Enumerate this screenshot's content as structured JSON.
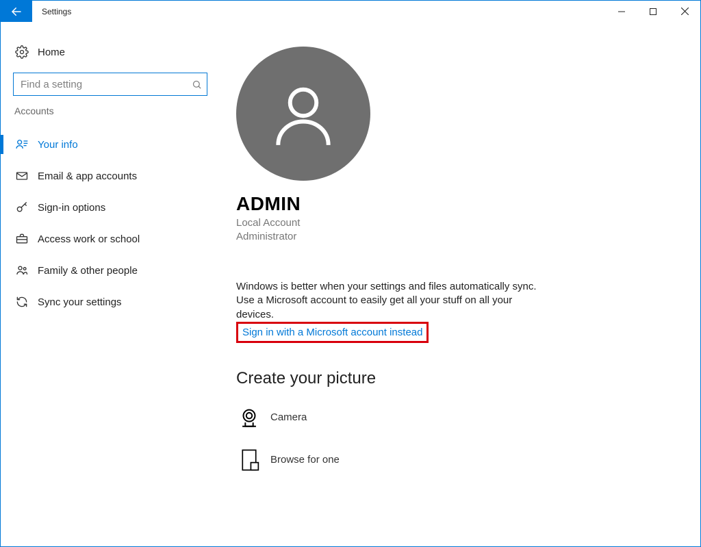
{
  "title": "Settings",
  "home_label": "Home",
  "search": {
    "placeholder": "Find a setting"
  },
  "section_header": "Accounts",
  "nav": [
    {
      "id": "your-info",
      "label": "Your info",
      "selected": true
    },
    {
      "id": "email-app",
      "label": "Email & app accounts",
      "selected": false
    },
    {
      "id": "signin-options",
      "label": "Sign-in options",
      "selected": false
    },
    {
      "id": "access-work",
      "label": "Access work or school",
      "selected": false
    },
    {
      "id": "family",
      "label": "Family & other people",
      "selected": false
    },
    {
      "id": "sync",
      "label": "Sync your settings",
      "selected": false
    }
  ],
  "account": {
    "name": "ADMIN",
    "type": "Local Account",
    "role": "Administrator"
  },
  "sync_blurb": "Windows is better when your settings and files automatically sync. Use a Microsoft account to easily get all your stuff on all your devices.",
  "signin_link": "Sign in with a Microsoft account instead",
  "create_picture_title": "Create your picture",
  "picture_options": {
    "camera": "Camera",
    "browse": "Browse for one"
  }
}
